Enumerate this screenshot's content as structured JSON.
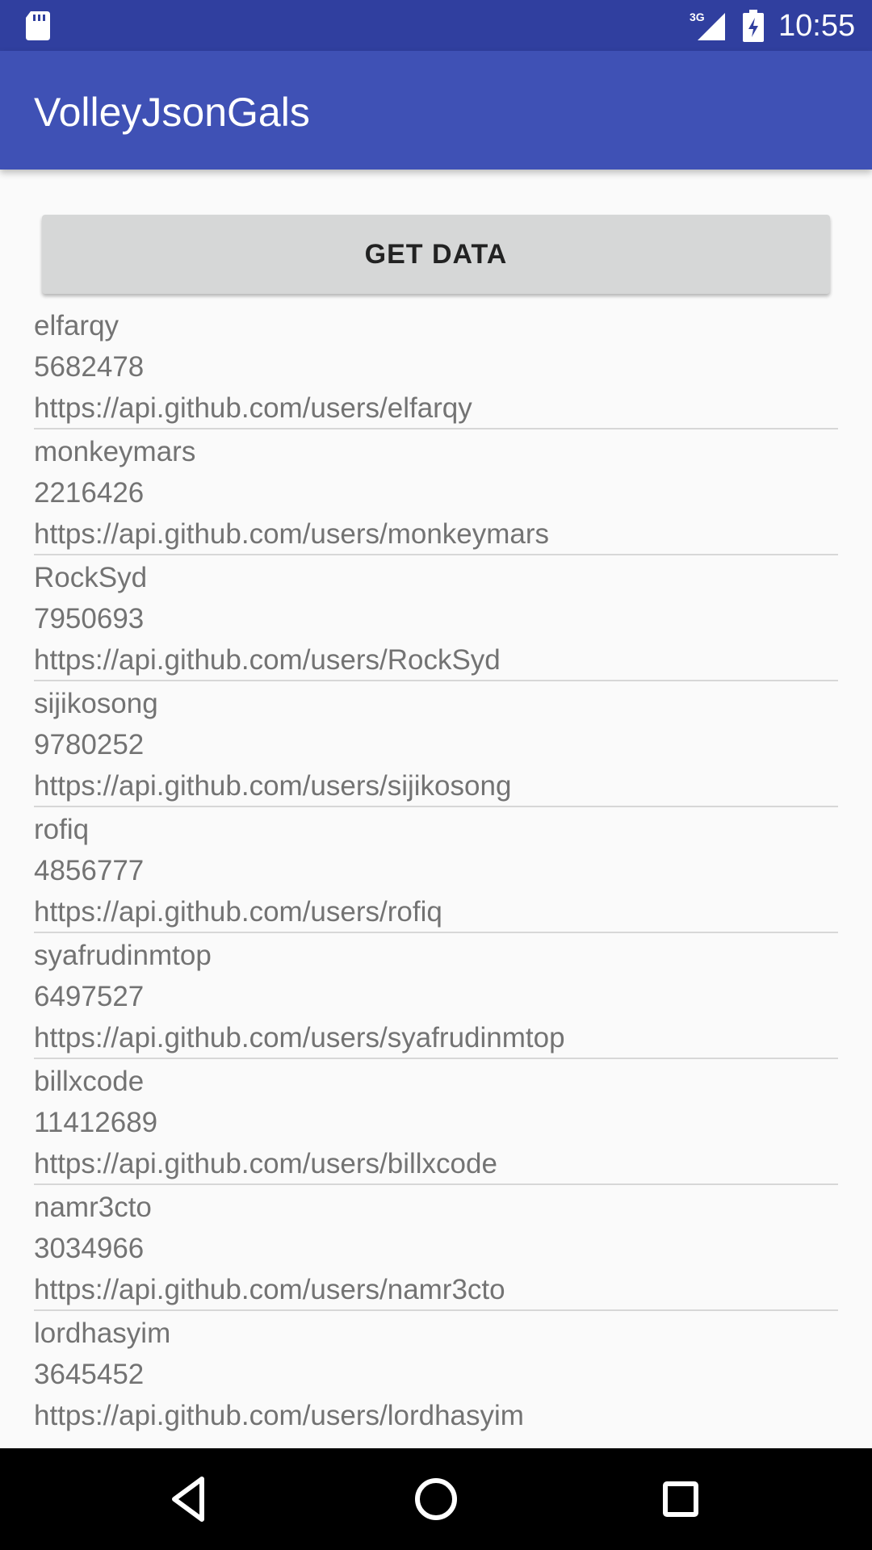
{
  "status_bar": {
    "time": "10:55",
    "network": "3G",
    "icons": [
      "sd-card-icon",
      "signal-3g-icon",
      "battery-charging-icon"
    ]
  },
  "app_bar": {
    "title": "VolleyJsonGals"
  },
  "button": {
    "label": "GET DATA"
  },
  "users": [
    {
      "login": "elfarqy",
      "id": "5682478",
      "url": "https://api.github.com/users/elfarqy"
    },
    {
      "login": "monkeymars",
      "id": "2216426",
      "url": "https://api.github.com/users/monkeymars"
    },
    {
      "login": "RockSyd",
      "id": "7950693",
      "url": "https://api.github.com/users/RockSyd"
    },
    {
      "login": "sijikosong",
      "id": "9780252",
      "url": "https://api.github.com/users/sijikosong"
    },
    {
      "login": "rofiq",
      "id": "4856777",
      "url": "https://api.github.com/users/rofiq"
    },
    {
      "login": "syafrudinmtop",
      "id": "6497527",
      "url": "https://api.github.com/users/syafrudinmtop"
    },
    {
      "login": "billxcode",
      "id": "11412689",
      "url": "https://api.github.com/users/billxcode"
    },
    {
      "login": "namr3cto",
      "id": "3034966",
      "url": "https://api.github.com/users/namr3cto"
    },
    {
      "login": "lordhasyim",
      "id": "3645452",
      "url": "https://api.github.com/users/lordhasyim"
    }
  ],
  "nav_bar": {
    "icons": [
      "back-icon",
      "home-icon",
      "recents-icon"
    ]
  },
  "colors": {
    "status_bar": "#303F9F",
    "app_bar": "#3F51B5",
    "background": "#FAFAFA",
    "button": "#D6D7D7"
  }
}
